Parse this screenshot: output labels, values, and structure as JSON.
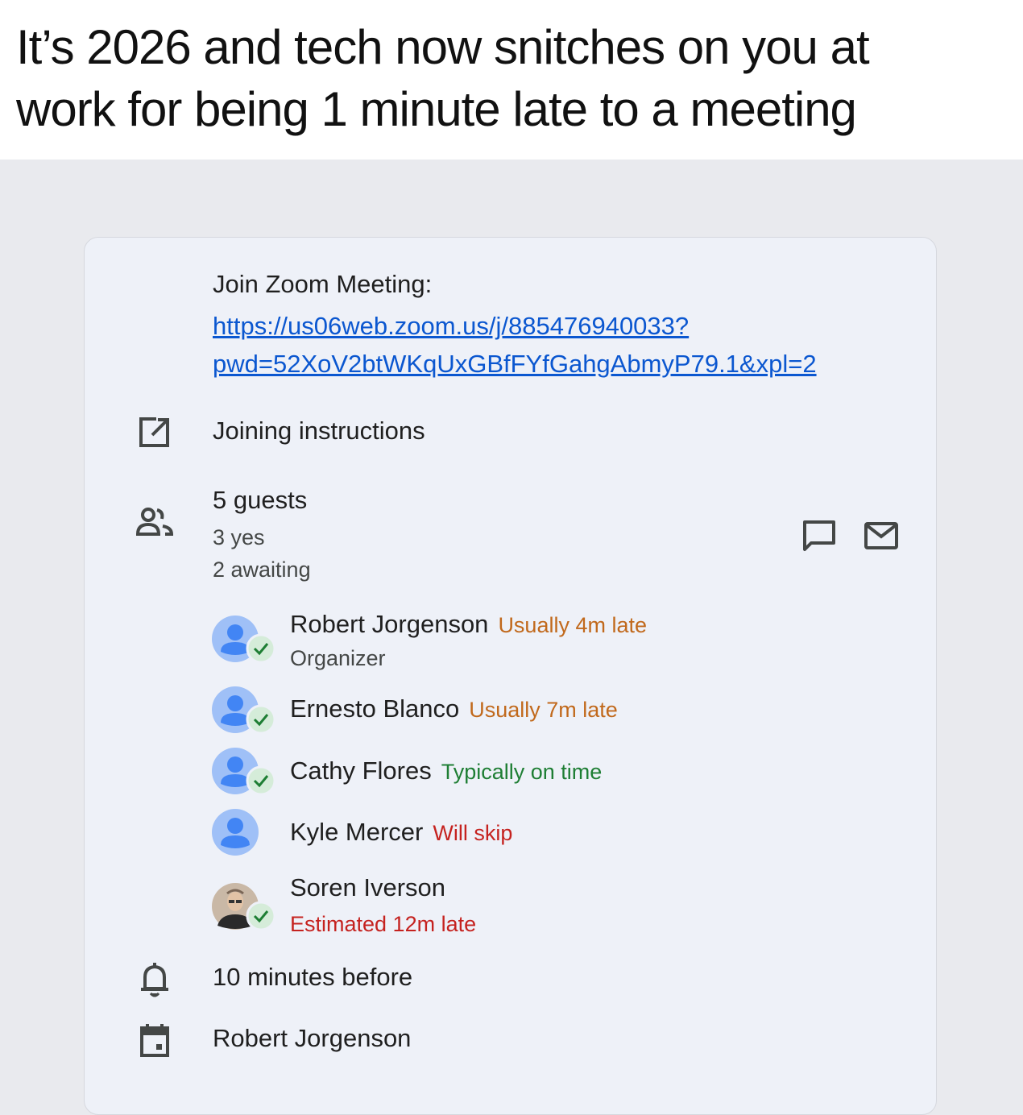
{
  "caption": {
    "line1": "It’s 2026 and tech now snitches on you at",
    "line2": "work for being 1 minute late to a meeting"
  },
  "event": {
    "join_title": "Join Zoom Meeting:",
    "join_link_line1": "https://us06web.zoom.us/j/885476940033?",
    "join_link_line2": "pwd=52XoV2btWKqUxGBfFYfGahgAbmyP79.1&xpl=2",
    "joining_instructions": "Joining instructions",
    "guests_count": "5 guests",
    "guests_yes": "3 yes",
    "guests_awaiting": "2 awaiting",
    "reminder": "10 minutes before",
    "calendar_owner": "Robert Jorgenson"
  },
  "guests": [
    {
      "name": "Robert Jorgenson",
      "status": "Usually 4m late",
      "role": "Organizer",
      "status_color": "#c1691c",
      "accepted": true
    },
    {
      "name": "Ernesto Blanco",
      "status": "Usually 7m late",
      "status_color": "#c1691c",
      "accepted": true
    },
    {
      "name": "Cathy Flores",
      "status": "Typically on time",
      "status_color": "#1e7e34",
      "accepted": true
    },
    {
      "name": "Kyle Mercer",
      "status": "Will skip",
      "status_color": "#c5221f",
      "accepted": false
    },
    {
      "name": "Soren Iverson",
      "status": "Estimated 12m late",
      "status_color": "#c5221f",
      "accepted": true,
      "photo": true
    }
  ],
  "icons": {
    "open_external": "open-in-new-icon",
    "people": "people-icon",
    "chat": "chat-bubble-icon",
    "email": "mail-icon",
    "bell": "bell-icon",
    "calendar": "calendar-icon",
    "accepted": "check-badge-icon"
  },
  "colors": {
    "link": "#0b57d0",
    "late": "#c1691c",
    "on_time": "#1e7e34",
    "red": "#c5221f",
    "avatar_blue": "#4285f4"
  }
}
